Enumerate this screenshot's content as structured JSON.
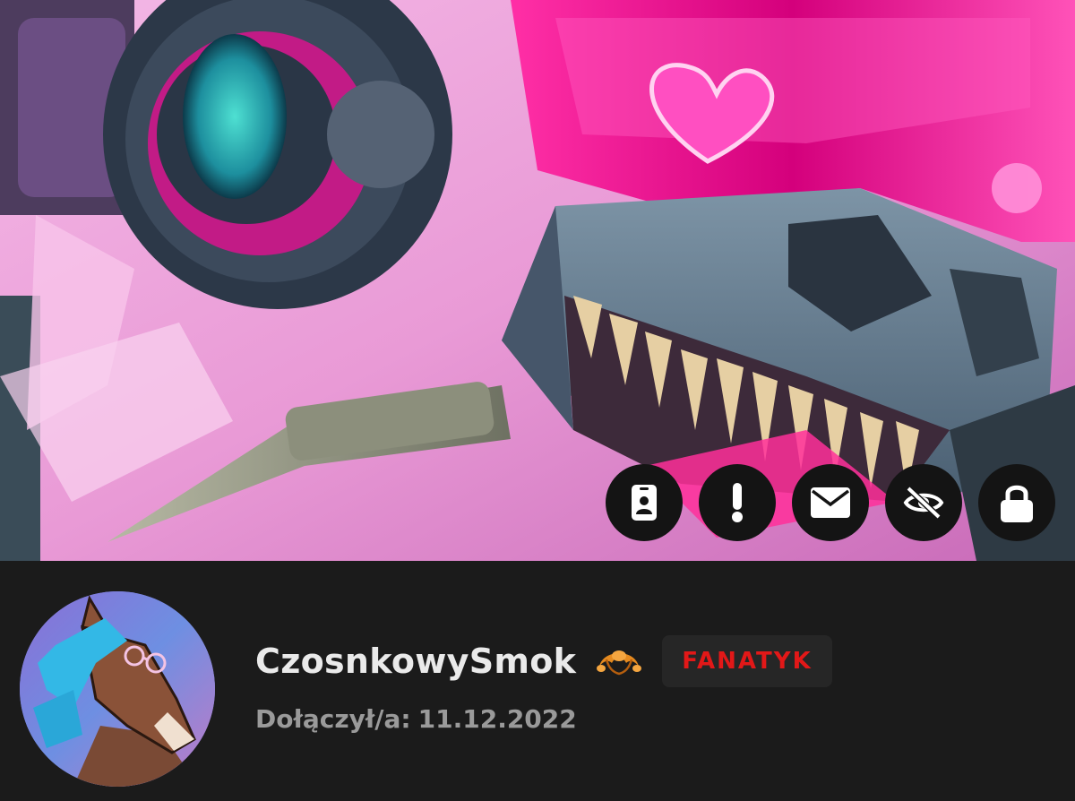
{
  "profile": {
    "username": "CzosnkowySmok",
    "rank_badge": "FANATYK",
    "joined_label": "Dołączył/a:",
    "joined_date": "11.12.2022",
    "rank_icon": "croissant-emoji",
    "avatar_image": "horse-with-blue-mane-and-glasses"
  },
  "banner": {
    "image": "cyberpunk-dragon-skull-with-pink-visor"
  },
  "actions": [
    {
      "icon": "id-card-icon"
    },
    {
      "icon": "exclamation-icon"
    },
    {
      "icon": "envelope-icon"
    },
    {
      "icon": "eye-slash-icon"
    },
    {
      "icon": "lock-icon"
    }
  ],
  "colors": {
    "background": "#1b1b1b",
    "username": "#eaeaea",
    "rank_badge_text": "#e21818",
    "rank_badge_bg": "#262626",
    "joined_text": "#9a9a9a",
    "action_button_bg": "#141414"
  }
}
